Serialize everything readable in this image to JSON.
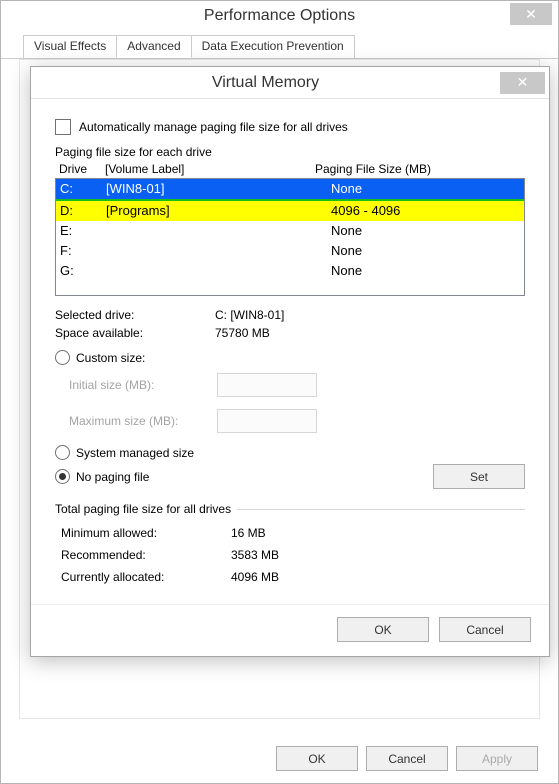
{
  "perf": {
    "title": "Performance Options",
    "tabs": [
      "Visual Effects",
      "Advanced",
      "Data Execution Prevention"
    ],
    "active_tab": 1,
    "buttons": {
      "ok": "OK",
      "cancel": "Cancel",
      "apply": "Apply"
    }
  },
  "vm": {
    "title": "Virtual Memory",
    "auto_manage_label": "Automatically manage paging file size for all drives",
    "auto_manage_checked": false,
    "section_label": "Paging file size for each drive",
    "headers": {
      "drive": "Drive",
      "volume": "[Volume Label]",
      "size": "Paging File Size (MB)"
    },
    "drives": [
      {
        "drive": "C:",
        "label": "[WIN8-01]",
        "size": "None",
        "selected": true,
        "highlighted": false
      },
      {
        "drive": "D:",
        "label": "[Programs]",
        "size": "4096 - 4096",
        "selected": false,
        "highlighted": true
      },
      {
        "drive": "E:",
        "label": "",
        "size": "None",
        "selected": false,
        "highlighted": false
      },
      {
        "drive": "F:",
        "label": "",
        "size": "None",
        "selected": false,
        "highlighted": false
      },
      {
        "drive": "G:",
        "label": "",
        "size": "None",
        "selected": false,
        "highlighted": false
      }
    ],
    "selected_drive_label": "Selected drive:",
    "selected_drive_value": "C:   [WIN8-01]",
    "space_available_label": "Space available:",
    "space_available_value": "75780 MB",
    "radios": {
      "custom": "Custom size:",
      "system_managed": "System managed size",
      "no_paging": "No paging file",
      "selected": "no_paging"
    },
    "initial_size_label": "Initial size (MB):",
    "initial_size_value": "",
    "max_size_label": "Maximum size (MB):",
    "max_size_value": "",
    "set_label": "Set",
    "totals_legend": "Total paging file size for all drives",
    "min_allowed_label": "Minimum allowed:",
    "min_allowed_value": "16 MB",
    "recommended_label": "Recommended:",
    "recommended_value": "3583 MB",
    "currently_allocated_label": "Currently allocated:",
    "currently_allocated_value": "4096 MB",
    "buttons": {
      "ok": "OK",
      "cancel": "Cancel"
    }
  }
}
